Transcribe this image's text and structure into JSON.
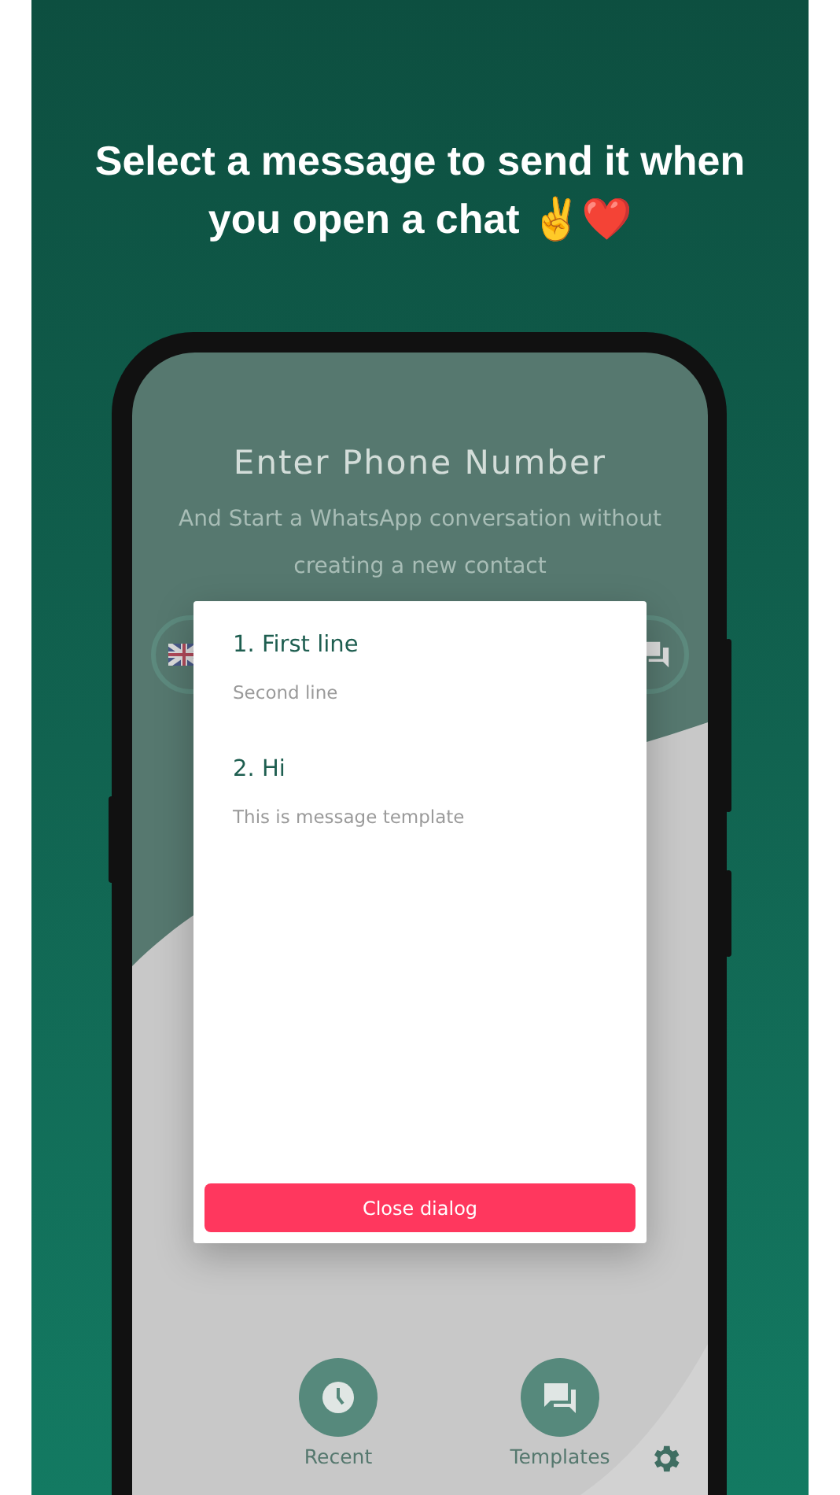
{
  "headline": "Select a message to send it when you open a chat ✌️❤️",
  "screen": {
    "title": "Enter Phone Number",
    "subtitle": "And Start a WhatsApp conversation without creating a new contact"
  },
  "dialog": {
    "templates": [
      {
        "title": "1. First line",
        "body": "Second line"
      },
      {
        "title": "2. Hi",
        "body": "This is message template"
      }
    ],
    "close_button": "Close dialog"
  },
  "bottom_nav": [
    {
      "label": "Recent",
      "kind": "clock"
    },
    {
      "label": "Templates",
      "kind": "chat"
    }
  ]
}
